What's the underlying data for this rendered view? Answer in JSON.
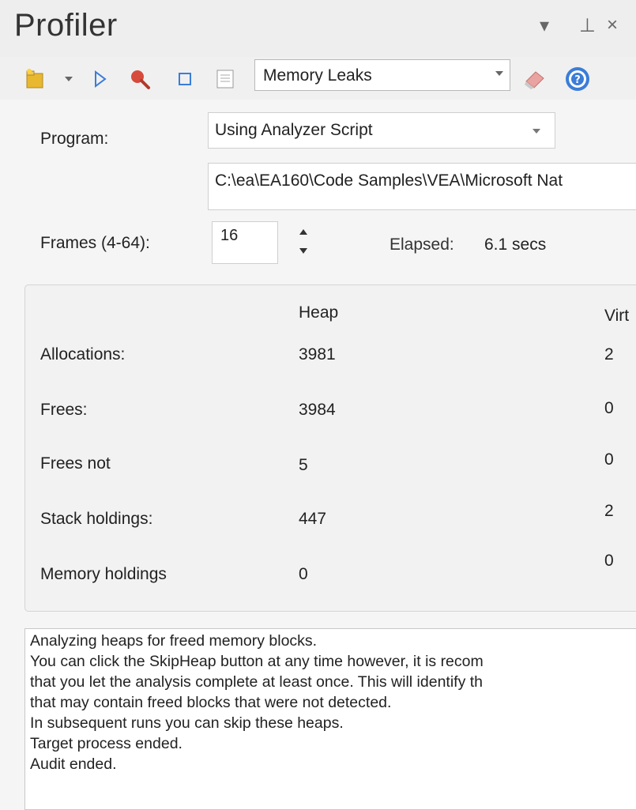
{
  "window": {
    "title": "Profiler",
    "buttons": [
      "▾",
      "⊥",
      "×"
    ]
  },
  "toolbar": {
    "icons": [
      "new-script-icon",
      "dropdown-icon",
      "run-icon",
      "record-icon",
      "stop-icon",
      "report-icon",
      "clear-icon",
      "help-icon"
    ],
    "mode": "Memory Leaks"
  },
  "form": {
    "program_label": "Program:",
    "program_value": "Using Analyzer Script",
    "path_value": "C:\\ea\\EA160\\Code Samples\\VEA\\Microsoft Nat",
    "frames_label": "Frames (4-64):",
    "frames_value": "16",
    "elapsed_label": "Elapsed:",
    "elapsed_value": "6.1 secs"
  },
  "stats": {
    "columns": [
      "Heap",
      "Virt"
    ],
    "rows": [
      {
        "label": "Allocations:",
        "heap": "3981",
        "virt": "2"
      },
      {
        "label": "Frees:",
        "heap": "3984",
        "virt": "0"
      },
      {
        "label": "Frees not",
        "heap": "5",
        "virt": "0"
      },
      {
        "label": "Stack holdings:",
        "heap": "447",
        "virt": "2"
      },
      {
        "label": "Memory holdings",
        "heap": "0",
        "virt": "0"
      }
    ]
  },
  "log": [
    "Analyzing heaps for freed memory blocks.",
    "You can click the SkipHeap button at any time however, it is recom",
    "that you let the analysis complete at least once. This will identify th",
    "that may contain freed blocks that were not detected.",
    "In subsequent runs you can skip these heaps.",
    "Target process ended.",
    "Audit ended."
  ],
  "colors": {
    "accent_blue": "#3b7dd8",
    "record_red": "#d64b3c",
    "folder_yellow": "#e8b830"
  }
}
